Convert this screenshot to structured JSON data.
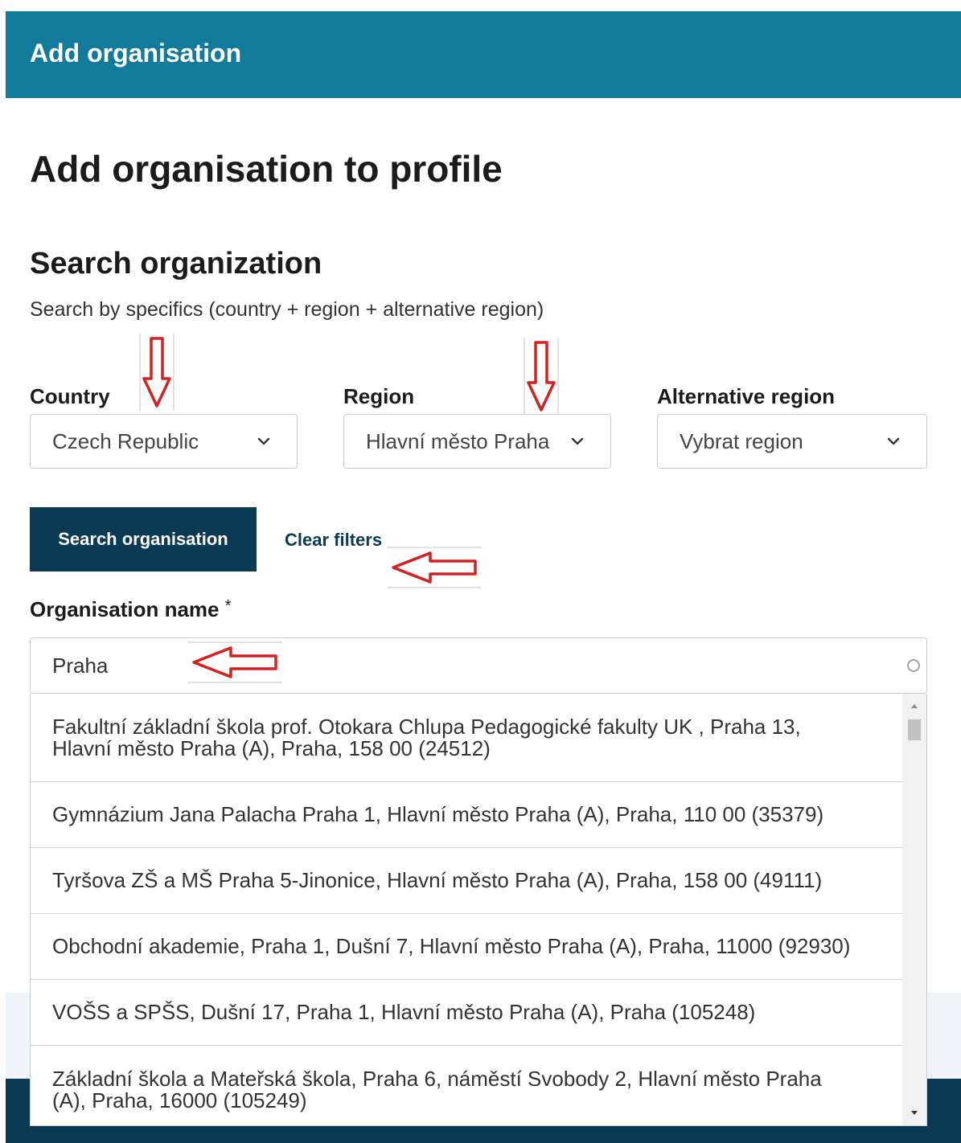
{
  "header": {
    "title": "Add organisation"
  },
  "page": {
    "title": "Add organisation to profile"
  },
  "search": {
    "title": "Search organization",
    "description": "Search by specifics (country + region + alternative region)",
    "country": {
      "label": "Country",
      "value": "Czech Republic"
    },
    "region": {
      "label": "Region",
      "value": "Hlavní město Praha"
    },
    "alternative_region": {
      "label": "Alternative region",
      "value": "Vybrat region"
    },
    "search_button": "Search organisation",
    "clear_link": "Clear filters"
  },
  "organisation": {
    "label": "Organisation name",
    "required_mark": "*",
    "value": "Praha",
    "results": [
      {
        "line1": "Fakultní základní škola prof. Otokara Chlupa Pedagogické fakulty UK , Praha 13,",
        "line2": "Hlavní město Praha (A), Praha, 158 00 (24512)"
      },
      {
        "line1": "Gymnázium Jana Palacha Praha 1, Hlavní město Praha (A), Praha, 110 00 (35379)"
      },
      {
        "line1": "Tyršova ZŠ a MŠ Praha 5-Jinonice, Hlavní město Praha (A), Praha, 158 00 (49111)"
      },
      {
        "line1": "Obchodní akademie, Praha 1, Dušní 7, Hlavní město Praha (A), Praha, 11000 (92930)"
      },
      {
        "line1": "VOŠS a SPŠS, Dušní 17, Praha 1, Hlavní město Praha (A), Praha (105248)"
      },
      {
        "line1": "Základní škola a Mateřská škola, Praha 6, náměstí Svobody 2, Hlavní město Praha",
        "line2": "(A), Praha, 16000 (105249)"
      }
    ]
  },
  "colors": {
    "header_bg": "#127b9c",
    "primary_button": "#0b3a55",
    "annotation_red": "#d42020"
  }
}
